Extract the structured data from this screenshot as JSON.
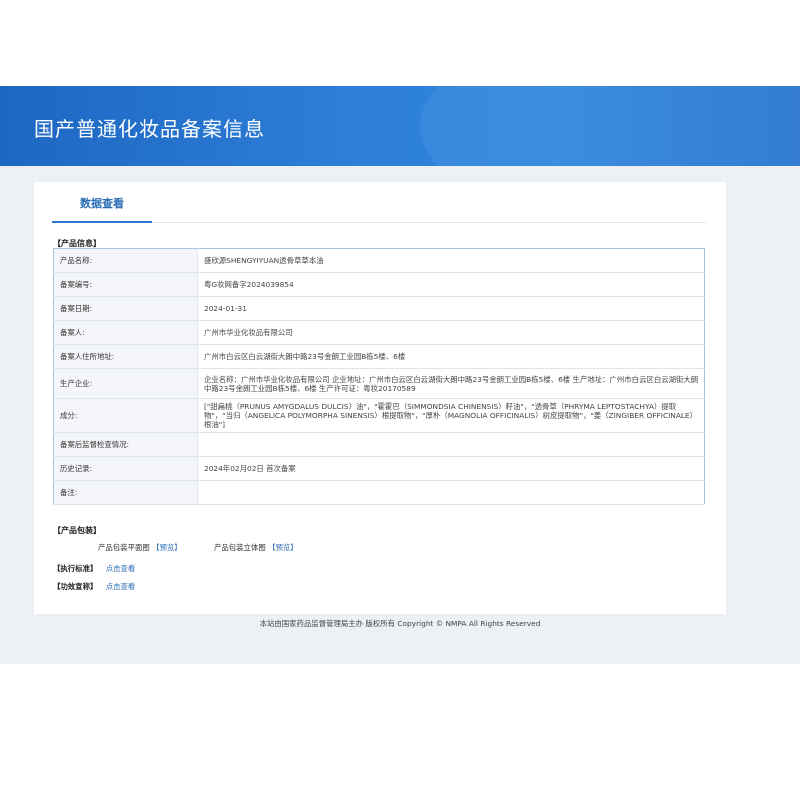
{
  "banner": {
    "title": "国产普通化妆品备案信息"
  },
  "tabs": [
    {
      "label": "数据查看",
      "active": true
    }
  ],
  "product_info": {
    "section_title": "【产品信息】",
    "rows": [
      {
        "label": "产品名称:",
        "value": "盛欣源SHENGYIYUAN透骨草草本油"
      },
      {
        "label": "备案编号:",
        "value": "粤G妆网备字2024039854"
      },
      {
        "label": "备案日期:",
        "value": "2024-01-31"
      },
      {
        "label": "备案人:",
        "value": "广州市华业化妆品有限公司"
      },
      {
        "label": "备案人住所地址:",
        "value": "广州市白云区白云湖街大朗中路23号金朗工业园B栋5楼、6楼"
      },
      {
        "label": "生产企业:",
        "value": "企业名称：广州市华业化妆品有限公司 企业地址：广州市白云区白云湖街大朗中路23号金朗工业园B栋5楼、6楼 生产地址：广州市白云区白云湖街大朗中路23号金朗工业园B栋5楼、6楼 生产许可证：粤妆20170589"
      },
      {
        "label": "成分:",
        "value": "[\"甜扁桃（PRUNUS AMYGDALUS DULCIS）油\"，\"霍霍巴（SIMMONDSIA CHINENSIS）籽油\"，\"透骨草（PHRYMA LEPTOSTACHYA）提取物\"，\"当归（ANGELICA POLYMORPHA SINENSIS）根提取物\"，\"厚朴（MAGNOLIA OFFICINALIS）树皮提取物\"，\"姜（ZINGIBER OFFICINALE）根油\"]"
      },
      {
        "label": "备案后监督检查情况:",
        "value": ""
      },
      {
        "label": "历史记录:",
        "value": "2024年02月02日 首次备案"
      },
      {
        "label": "备注:",
        "value": ""
      }
    ]
  },
  "packaging": {
    "section_title": "【产品包装】",
    "flat_label": "产品包装平面图",
    "flat_link": "【预览】",
    "three_d_label": "产品包装立体图",
    "three_d_link": "【预览】"
  },
  "standard": {
    "label": "【执行标准】",
    "link": "点击查看"
  },
  "efficacy": {
    "label": "【功效宣称】",
    "link": "点击查看"
  },
  "footer": {
    "text": "本站由国家药品监督管理局主办 版权所有 Copyright © NMPA All Rights Reserved"
  },
  "colors": {
    "banner": "#2e7fd9",
    "accent": "#2a6db5",
    "table_border": "#a9c0e0",
    "page_bg": "#edf0f4"
  }
}
